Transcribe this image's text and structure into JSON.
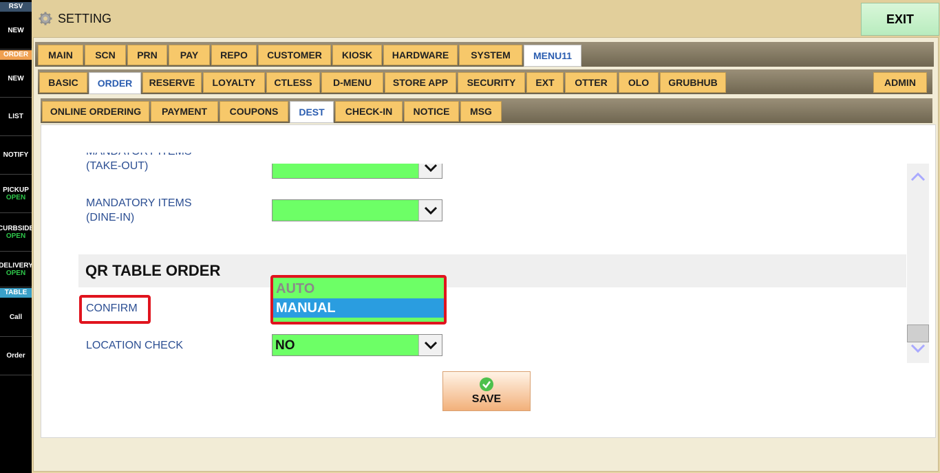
{
  "sidebar": {
    "rsv_header": "RSV",
    "rsv_new": "NEW",
    "order_header": "ORDER",
    "order_new": "NEW",
    "list": "LIST",
    "notify": "NOTIFY",
    "pickup": {
      "label": "PICKUP",
      "status": "OPEN"
    },
    "curbside": {
      "label": "CURBSIDE",
      "status": "OPEN"
    },
    "delivery": {
      "label": "DELIVERY",
      "status": "OPEN"
    },
    "table_header": "TABLE",
    "call": "Call",
    "order": "Order"
  },
  "header": {
    "title": "SETTING",
    "exit_label": "EXIT"
  },
  "tabs_level1": [
    "MAIN",
    "SCN",
    "PRN",
    "PAY",
    "REPO",
    "CUSTOMER",
    "KIOSK",
    "HARDWARE",
    "SYSTEM",
    "MENU11"
  ],
  "tabs_level2": [
    "BASIC",
    "ORDER",
    "RESERVE",
    "LOYALTY",
    "CTLESS",
    "D-MENU",
    "STORE APP",
    "SECURITY",
    "EXT",
    "OTTER",
    "OLO",
    "GRUBHUB",
    "ADMIN"
  ],
  "tabs_level3": [
    "ONLINE ORDERING",
    "PAYMENT",
    "COUPONS",
    "DEST",
    "CHECK-IN",
    "NOTICE",
    "MSG"
  ],
  "active_tabs": {
    "level1": "MENU11",
    "level2": "ORDER",
    "level3": "DEST"
  },
  "form": {
    "mandatory_takeout": {
      "label_line1": "MANDATORY ITEMS",
      "label_line2": "(TAKE-OUT)",
      "value": ""
    },
    "mandatory_dinein": {
      "label_line1": "MANDATORY ITEMS",
      "label_line2": "(DINE-IN)",
      "value": ""
    },
    "section_title": "QR TABLE ORDER",
    "confirm": {
      "label": "CONFIRM",
      "options": [
        "AUTO",
        "MANUAL"
      ],
      "highlighted": "MANUAL"
    },
    "location_check": {
      "label": "LOCATION CHECK",
      "value": "NO"
    }
  },
  "save_label": "SAVE",
  "colors": {
    "combo_green": "#6dff66",
    "highlight_blue": "#2a9de0",
    "callout_red": "#e0141e",
    "tab_active_text": "#2a5db0",
    "label_blue": "#2c4f93"
  }
}
